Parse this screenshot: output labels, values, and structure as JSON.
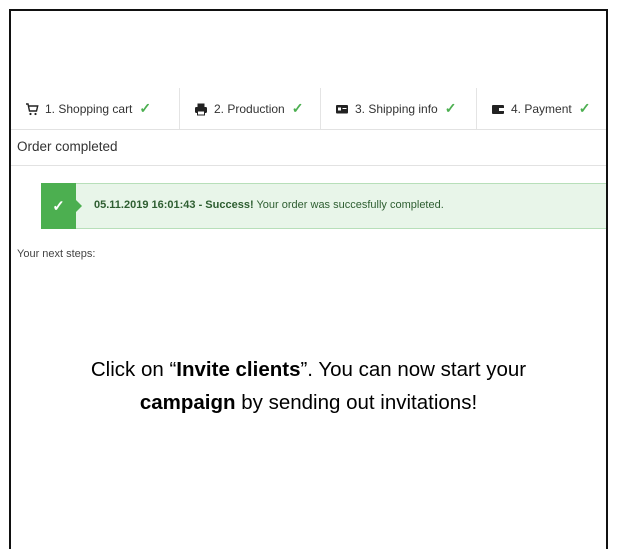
{
  "steps": [
    {
      "label": "1. Shopping cart",
      "icon": "cart-icon"
    },
    {
      "label": "2. Production",
      "icon": "printer-icon"
    },
    {
      "label": "3. Shipping info",
      "icon": "id-card-icon"
    },
    {
      "label": "4. Payment",
      "icon": "wallet-icon"
    }
  ],
  "section_title": "Order completed",
  "alert": {
    "timestamp": "05.11.2019 16:01:43 - Success!",
    "message": " Your order was succesfully completed.",
    "color": "#4caf50"
  },
  "next_steps_label": "Your next steps:",
  "caption": {
    "part1": "Click on “",
    "bold1": "Invite clients",
    "part2": "”. You can now start your",
    "bold2": "campaign",
    "part3": " by sending out invitations!"
  }
}
